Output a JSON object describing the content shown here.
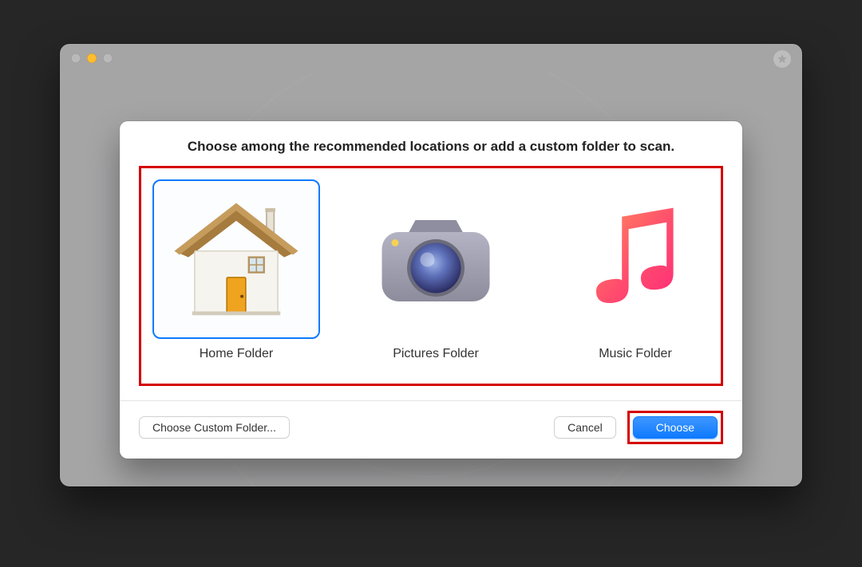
{
  "window": {
    "traffic": {
      "close": "close",
      "minimize": "minimize",
      "maximize": "maximize"
    },
    "star_icon": "star"
  },
  "dialog": {
    "title": "Choose among the recommended locations or add a custom folder to scan.",
    "options": [
      {
        "id": "home",
        "label": "Home Folder",
        "icon": "home-icon",
        "selected": true
      },
      {
        "id": "pictures",
        "label": "Pictures Folder",
        "icon": "camera-icon",
        "selected": false
      },
      {
        "id": "music",
        "label": "Music Folder",
        "icon": "music-icon",
        "selected": false
      }
    ],
    "buttons": {
      "custom": "Choose Custom Folder...",
      "cancel": "Cancel",
      "choose": "Choose"
    },
    "annotations": {
      "options_box": true,
      "choose_box": true
    }
  }
}
